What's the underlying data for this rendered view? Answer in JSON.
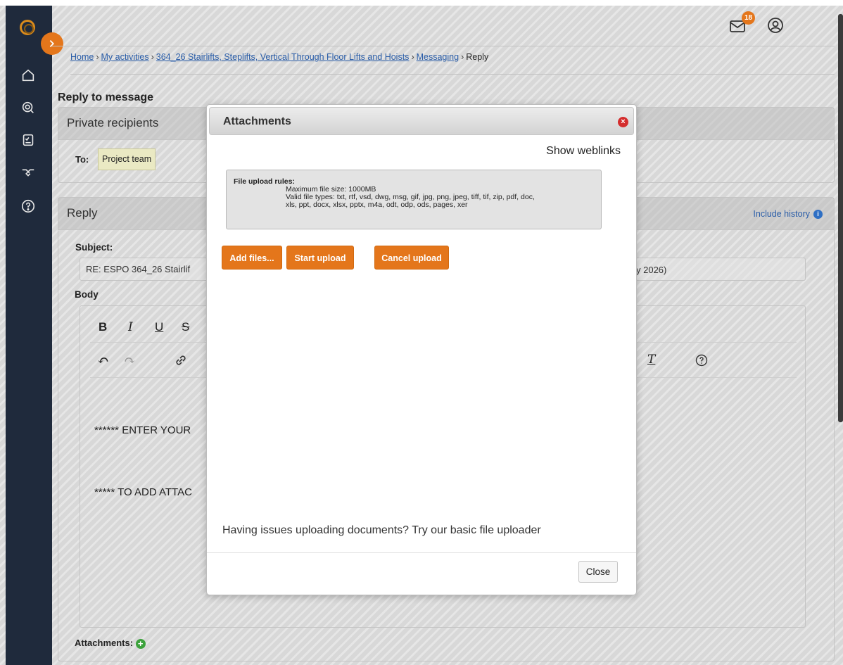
{
  "header": {
    "mail_badge": "18"
  },
  "breadcrumb": {
    "items": [
      "Home",
      "My activities",
      "364_26 Stairlifts, Steplifts, Vertical Through Floor Lifts and Hoists",
      "Messaging"
    ],
    "separator": "›",
    "current": "Reply"
  },
  "page": {
    "title": "Reply to message"
  },
  "recipients": {
    "heading": "Private recipients",
    "to_label": "To:",
    "recipient": "Project team"
  },
  "reply": {
    "heading": "Reply",
    "include_history": "Include history",
    "subject_label": "Subject:",
    "subject_value": "RE: ESPO 364_26 Stairlif",
    "subject_tail": "y 2026)",
    "body_label": "Body",
    "body_line1": "****** ENTER YOUR",
    "body_line2": "***** TO ADD ATTAC",
    "attachments_label": "Attachments:"
  },
  "editor_toolbar": {
    "bold": "B",
    "italic": "I",
    "underline": "U",
    "strike": "S",
    "undo": "↶",
    "redo": "↷",
    "clear_format": "T",
    "help": "?"
  },
  "modal": {
    "title": "Attachments",
    "show_weblinks": "Show weblinks",
    "rules_title": "File upload rules:",
    "rules_max_size": "Maximum file size: 1000MB",
    "rules_types_1": "Valid file types: txt, rtf, vsd, dwg, msg, gif, jpg, png, jpeg, tiff, tif, zip, pdf, doc,",
    "rules_types_2": "xls, ppt, docx, xlsx, pptx, m4a, odt, odp, ods, pages, xer",
    "add_files": "Add files...",
    "start_upload": "Start upload",
    "cancel_upload": "Cancel upload",
    "help_text": "Having issues uploading documents? Try our basic file uploader",
    "close": "Close"
  },
  "colors": {
    "accent_orange": "#e4761b",
    "sidebar": "#1f2a3c",
    "link_blue": "#2a5da8"
  },
  "icons": [
    "logo-icon",
    "chevron-right-icon",
    "home-icon",
    "search-icon",
    "clipboard-icon",
    "handshake-icon",
    "help-icon",
    "mail-icon",
    "user-icon",
    "close-icon",
    "add-icon",
    "info-icon",
    "link-icon"
  ]
}
